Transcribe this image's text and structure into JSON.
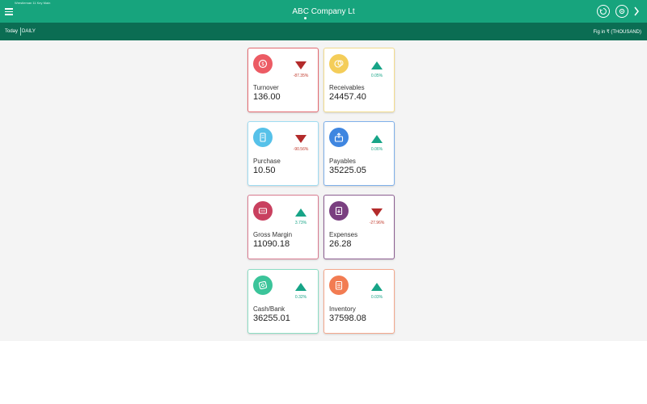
{
  "header": {
    "tiny_text": "Wrestleman 11 Key Main",
    "title": "ABC Company Lt",
    "accent": "#17a47d",
    "subbar_bg": "#0b6d53"
  },
  "subbar": {
    "today_label": "Today",
    "period_label": "DAILY",
    "figures_label": "Fig in ₹ (THOUSAND)"
  },
  "cards": [
    {
      "label": "Turnover",
      "value": "136.00",
      "change": "-87.35%",
      "direction": "down",
      "icon": "money-bag-icon",
      "color": "#ec5b64",
      "border": "#e46a71"
    },
    {
      "label": "Receivables",
      "value": "24457.40",
      "change": "0.05%",
      "direction": "up",
      "icon": "coin-stack-icon",
      "color": "#f4cd59",
      "border": "#f3dc8d"
    },
    {
      "label": "Purchase",
      "value": "10.50",
      "change": "-90.56%",
      "direction": "down",
      "icon": "receipt-icon",
      "color": "#56c1e9",
      "border": "#9fdcf2"
    },
    {
      "label": "Payables",
      "value": "35225.05",
      "change": "0.06%",
      "direction": "up",
      "icon": "outbox-icon",
      "color": "#3f86e0",
      "border": "#7fb0ea"
    },
    {
      "label": "Gross Margin",
      "value": "11090.18",
      "change": "3.73%",
      "direction": "up",
      "icon": "cart-icon",
      "color": "#c9405f",
      "border": "#d97b90"
    },
    {
      "label": "Expenses",
      "value": "26.28",
      "change": "-27.96%",
      "direction": "down",
      "icon": "hand-cash-icon",
      "color": "#7a3f80",
      "border": "#8c5e91"
    },
    {
      "label": "Cash/Bank",
      "value": "36255.01",
      "change": "0.32%",
      "direction": "up",
      "icon": "banknote-icon",
      "color": "#3bc49a",
      "border": "#8dddc4"
    },
    {
      "label": "Inventory",
      "value": "37598.08",
      "change": "0.03%",
      "direction": "up",
      "icon": "clipboard-icon",
      "color": "#f27c52",
      "border": "#f4a98d"
    }
  ],
  "status_colors": {
    "up": "#17a487",
    "down": "#b32b2b",
    "up_text": "#17a487",
    "down_text": "#c0392b"
  }
}
